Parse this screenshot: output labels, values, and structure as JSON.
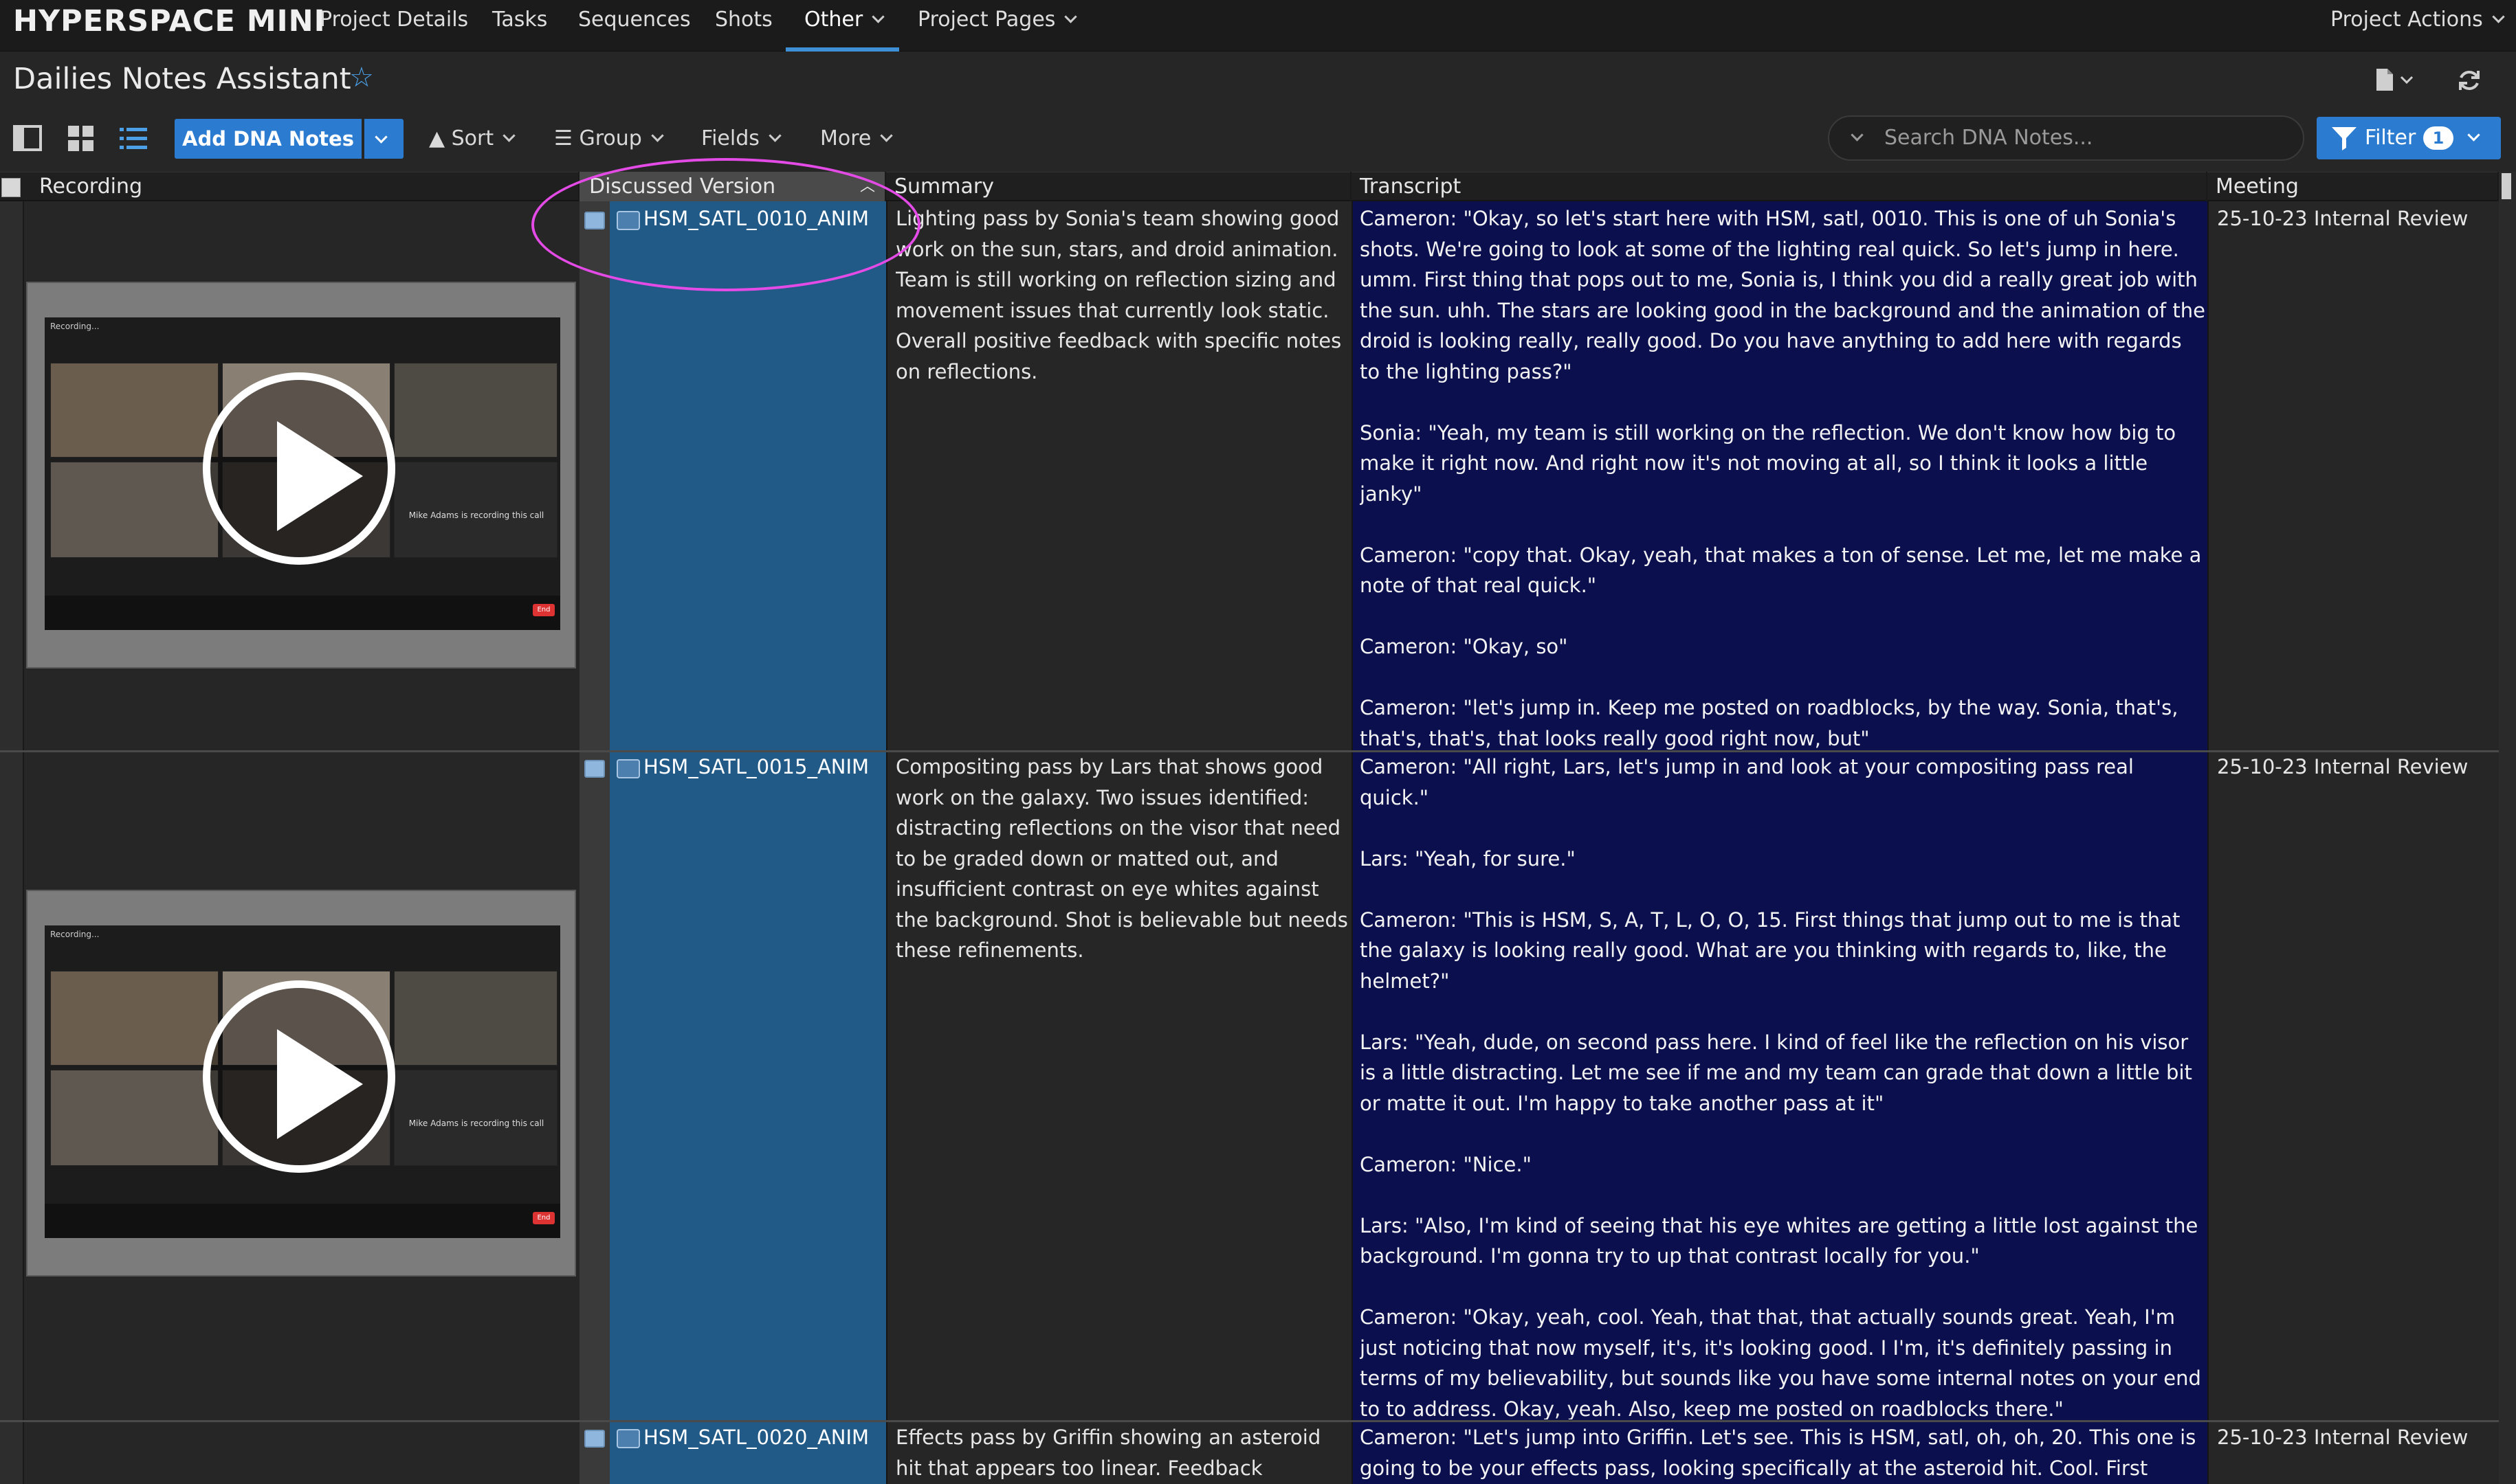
{
  "app": {
    "name": "HYPERSPACE MINI"
  },
  "nav": {
    "items": [
      "Project Details",
      "Tasks",
      "Sequences",
      "Shots",
      "Other",
      "Project Pages"
    ],
    "active": "Other",
    "project_actions": "Project Actions"
  },
  "page": {
    "title": "Dailies Notes Assistant"
  },
  "toolbar": {
    "add_label": "Add DNA Notes",
    "sort": "Sort",
    "group": "Group",
    "fields": "Fields",
    "more": "More",
    "search_placeholder": "Search DNA Notes...",
    "filter": "Filter",
    "filter_count": "1"
  },
  "columns": [
    "Recording",
    "Discussed Version",
    "Summary",
    "Transcript",
    "Meeting"
  ],
  "rows": [
    {
      "version": "HSM_SATL_0010_ANIM",
      "summary": "Lighting pass by Sonia's team showing good work on the sun, stars, and droid animation. Team is still working on reflection sizing and movement issues that currently look static. Overall positive feedback with specific notes on reflections.",
      "transcript": "Cameron: \"Okay, so let's start here with HSM, satl, 0010. This is one of uh Sonia's shots. We're going to look at some of the lighting real quick. So let's jump in here. umm. First thing that pops out to me, Sonia is, I think you did a really great job with the sun. uhh. The stars are looking good in the background and the animation of the droid is looking really, really good. Do you have anything to add here with regards to the lighting pass?\"\n\nSonia: \"Yeah, my team is still working on the reflection. We don't know how big to make it right now. And right now it's not moving at all, so I think it looks a little janky\"\n\nCameron: \"copy that. Okay, yeah, that makes a ton of sense. Let me, let me make a note of that real quick.\"\n\nCameron: \"Okay, so\"\n\nCameron: \"let's jump in. Keep me posted on roadblocks, by the way. Sonia, that's, that's, that's, that looks really good right now, but\"\n\nSonia: \"yeah, definitely.\"",
      "meeting": "25-10-23 Internal Review"
    },
    {
      "version": "HSM_SATL_0015_ANIM",
      "summary": "Compositing pass by Lars that shows good work on the galaxy. Two issues identified: distracting reflections on the visor that need to be graded down or matted out, and insufficient contrast on eye whites against the background. Shot is believable but needs these refinements.",
      "transcript": "Cameron: \"All right, Lars, let's jump in and look at your compositing pass real quick.\"\n\nLars: \"Yeah, for sure.\"\n\nCameron: \"This is HSM, S, A, T, L, O, O, 15. First things that jump out to me is that the galaxy is looking really good. What are you thinking with regards to, like, the helmet?\"\n\nLars: \"Yeah, dude, on second pass here. I kind of feel like the reflection on his visor is a little distracting. Let me see if me and my team can grade that down a little bit or matte it out. I'm happy to take another pass at it\"\n\nCameron: \"Nice.\"\n\nLars: \"Also, I'm kind of seeing that his eye whites are getting a little lost against the background. I'm gonna try to up that contrast locally for you.\"\n\nCameron: \"Okay, yeah, cool. Yeah, that that, that actually sounds great. Yeah, I'm just noticing that now myself, it's, it's looking good. I I'm, it's definitely passing in terms of my believability, but sounds like you have some internal notes on your end to to address. Okay, yeah. Also, keep me posted on roadblocks there.\"\n\nLars: \"Copy.\"",
      "meeting": "25-10-23 Internal Review"
    },
    {
      "version": "HSM_SATL_0020_ANIM",
      "summary": "Effects pass by Griffin showing an asteroid hit that appears too linear. Feedback includes",
      "transcript": "Cameron: \"Let's jump into Griffin. Let's see. This is HSM, satl, oh, oh, 20. This one is going to be your effects pass, looking specifically at the asteroid hit. Cool. First things",
      "meeting": "25-10-23 Internal Review"
    }
  ],
  "recording_overlay": {
    "recording_text": "Recording...",
    "notice": "Mike Adams is recording this call",
    "end": "End"
  },
  "colors": {
    "accent": "#2b7cd0",
    "version_col": "#215a87",
    "transcript_bg": "#0b0f4d",
    "annotation": "#e44be6"
  }
}
